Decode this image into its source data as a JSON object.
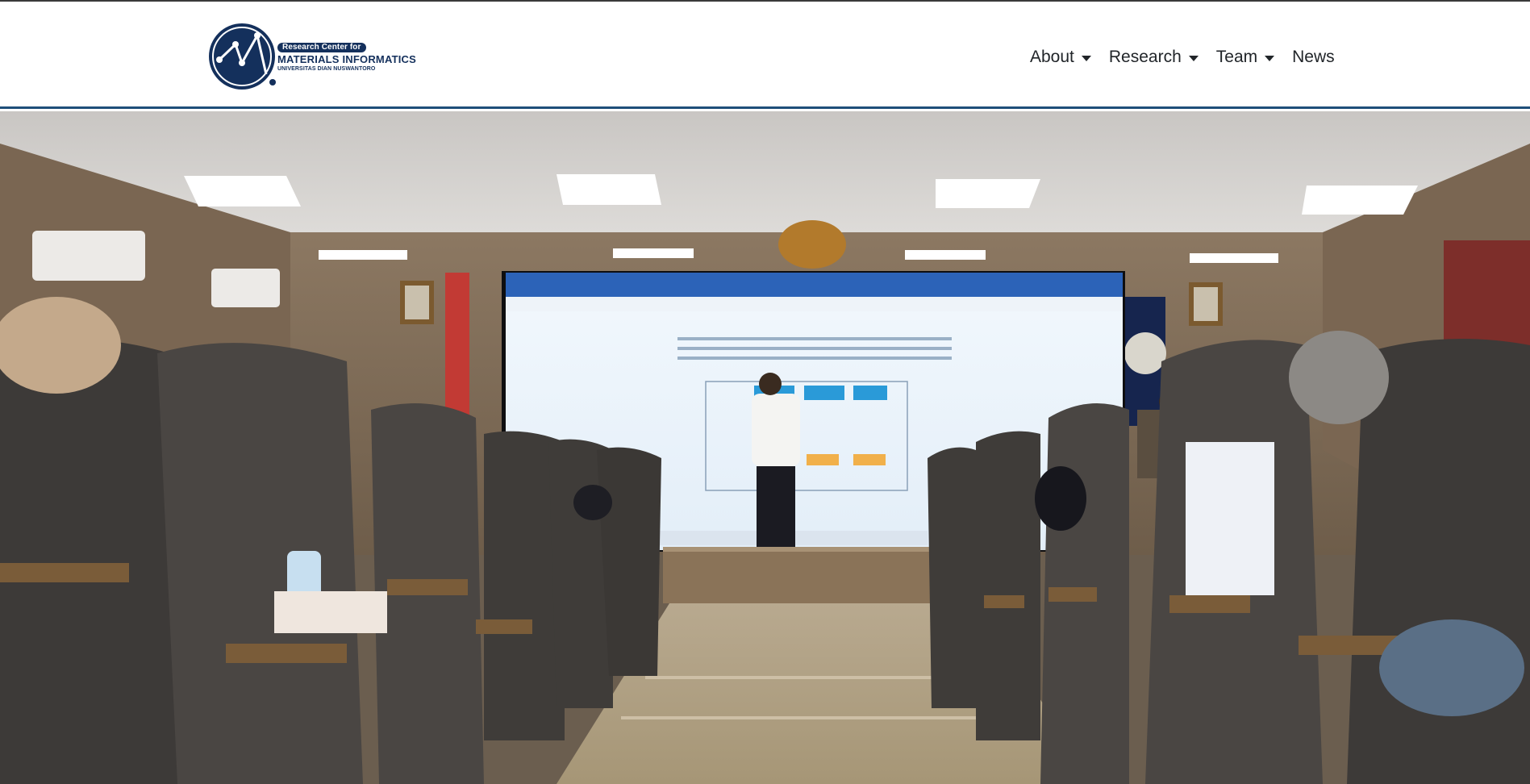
{
  "site": {
    "logo": {
      "line1": "Research Center for",
      "line2": "MATERIALS INFORMATICS",
      "line3": "UNIVERSITAS DIAN NUSWANTORO"
    }
  },
  "nav": {
    "items": [
      {
        "label": "About",
        "has_dropdown": true
      },
      {
        "label": "Research",
        "has_dropdown": true
      },
      {
        "label": "Team",
        "has_dropdown": true
      },
      {
        "label": "News",
        "has_dropdown": false
      }
    ]
  },
  "colors": {
    "brand": "#14305c",
    "header_border": "#1f4e79",
    "nav_text": "#212529"
  },
  "icons": {
    "logo": "network-chart-logo-icon",
    "dropdown": "caret-down-icon"
  },
  "hero": {
    "description_icon": "auditorium-photo"
  }
}
